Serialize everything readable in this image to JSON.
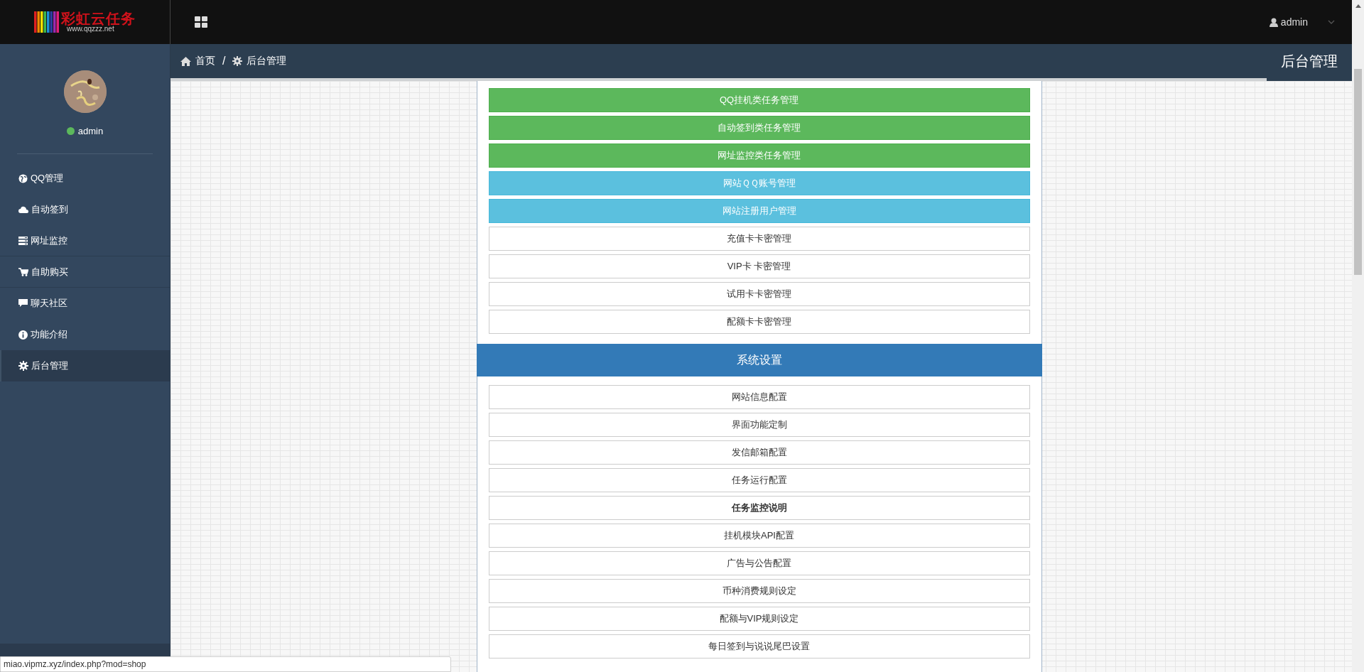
{
  "logo": {
    "title": "彩虹云任务",
    "subtitle": "www.qqzzz.net"
  },
  "top_bar": {
    "user": "admin"
  },
  "sidebar": {
    "profile": {
      "name": "admin",
      "online": true
    },
    "items": [
      {
        "label": "QQ管理",
        "selected": false
      },
      {
        "label": "自动签到",
        "selected": false
      },
      {
        "label": "网址监控",
        "selected": false
      },
      {
        "label": "自助购买",
        "selected": false
      },
      {
        "label": "聊天社区",
        "selected": false
      },
      {
        "label": "功能介绍",
        "selected": false
      },
      {
        "label": "后台管理",
        "selected": true
      }
    ]
  },
  "breadcrumb": [
    {
      "label": "首页"
    },
    {
      "label": "后台管理"
    }
  ],
  "breadcrumb_separator": "/",
  "page_title": "后台管理",
  "task_buttons": [
    {
      "label": "QQ挂机类任务管理",
      "kind": "success"
    },
    {
      "label": "自动签到类任务管理",
      "kind": "success"
    },
    {
      "label": "网址监控类任务管理",
      "kind": "success"
    },
    {
      "label": "网站ＱＱ账号管理",
      "kind": "info"
    },
    {
      "label": "网站注册用户管理",
      "kind": "info"
    },
    {
      "label": "充值卡卡密管理",
      "kind": "default"
    },
    {
      "label": "VIP卡 卡密管理",
      "kind": "default"
    },
    {
      "label": "试用卡卡密管理",
      "kind": "default"
    },
    {
      "label": "配额卡卡密管理",
      "kind": "default"
    }
  ],
  "settings": {
    "heading": "系统设置",
    "buttons": [
      {
        "label": "网站信息配置",
        "bold": false
      },
      {
        "label": "界面功能定制",
        "bold": false
      },
      {
        "label": "发信邮箱配置",
        "bold": false
      },
      {
        "label": "任务运行配置",
        "bold": false
      },
      {
        "label": "任务监控说明",
        "bold": true
      },
      {
        "label": "挂机模块API配置",
        "bold": false
      },
      {
        "label": "广告与公告配置",
        "bold": false
      },
      {
        "label": "币种消费规则设定",
        "bold": false
      },
      {
        "label": "配额与VIP规则设定",
        "bold": false
      },
      {
        "label": "每日签到与说说尾巴设置",
        "bold": false
      }
    ]
  },
  "status_url": "miao.vipmz.xyz/index.php?mod=shop"
}
